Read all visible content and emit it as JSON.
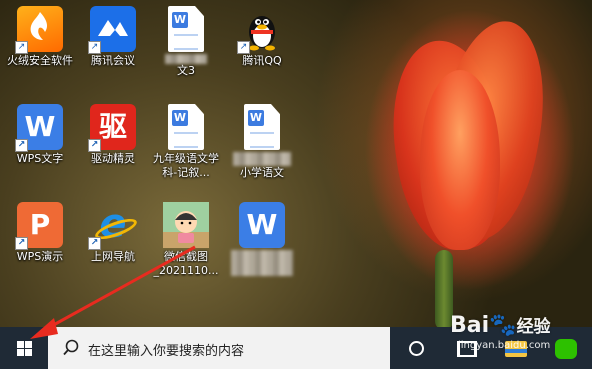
{
  "desktop": {
    "icons": [
      {
        "label": "火绒安全软件",
        "shortcut": true
      },
      {
        "label": "腾讯会议",
        "shortcut": true
      },
      {
        "label": "文3",
        "shortcut": false
      },
      {
        "label": "腾讯QQ",
        "shortcut": true
      },
      {
        "label": "WPS文字",
        "shortcut": true
      },
      {
        "label": "驱动精灵",
        "shortcut": true
      },
      {
        "label": "九年级语文学科-记叙...",
        "shortcut": false
      },
      {
        "label": "小学语文",
        "shortcut": false
      },
      {
        "label": "WPS演示",
        "shortcut": true
      },
      {
        "label": "上网导航",
        "shortcut": true
      },
      {
        "label": "微信截图_2021110...",
        "shortcut": false
      },
      {
        "label": "",
        "shortcut": false
      }
    ],
    "glyphs": {
      "wps_writer": "W",
      "wps_present": "P",
      "driver": "驱",
      "ie": "e",
      "doc": "W",
      "shortcut_arrow": "↗"
    }
  },
  "taskbar": {
    "search_placeholder": "在这里输入你要搜索的内容"
  },
  "watermark": {
    "brand": "Bai",
    "brand2": "经验",
    "url": "jingyan.baidu.com"
  },
  "colors": {
    "taskbar": "#1f2a36",
    "arrow": "#e82b1f",
    "accent_blue": "#3c7be0"
  }
}
